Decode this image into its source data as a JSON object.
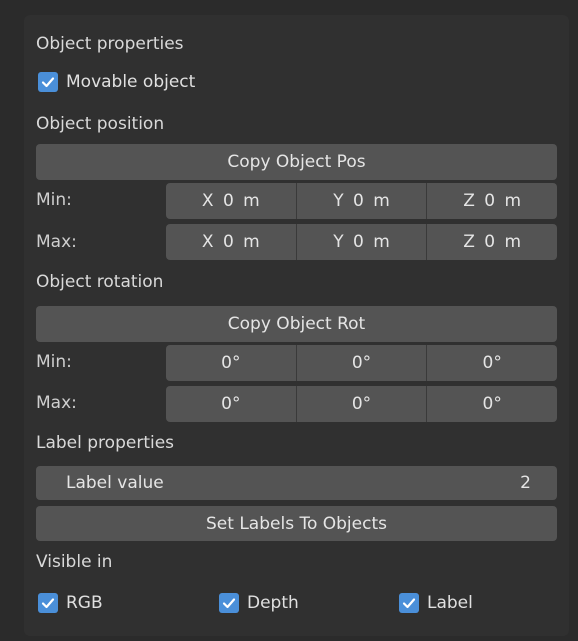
{
  "object_properties": {
    "heading": "Object properties",
    "movable_label": "Movable object",
    "movable_checked": true
  },
  "object_position": {
    "heading": "Object position",
    "copy_button": "Copy Object Pos",
    "min_label": "Min:",
    "max_label": "Max:",
    "min": [
      "X  0 m",
      "Y  0 m",
      "Z  0 m"
    ],
    "max": [
      "X  0 m",
      "Y  0 m",
      "Z  0 m"
    ]
  },
  "object_rotation": {
    "heading": "Object rotation",
    "copy_button": "Copy Object Rot",
    "min_label": "Min:",
    "max_label": "Max:",
    "min": [
      "0°",
      "0°",
      "0°"
    ],
    "max": [
      "0°",
      "0°",
      "0°"
    ]
  },
  "label_properties": {
    "heading": "Label properties",
    "value_label": "Label value",
    "value": "2",
    "set_button": "Set Labels To Objects"
  },
  "visible_in": {
    "heading": "Visible in",
    "options": [
      {
        "label": "RGB",
        "checked": true
      },
      {
        "label": "Depth",
        "checked": true
      },
      {
        "label": "Label",
        "checked": true
      }
    ]
  },
  "colors": {
    "background": "#2b2b2b",
    "panel": "#303030",
    "field": "#545454",
    "checkbox_accent": "#4a8fd9"
  }
}
